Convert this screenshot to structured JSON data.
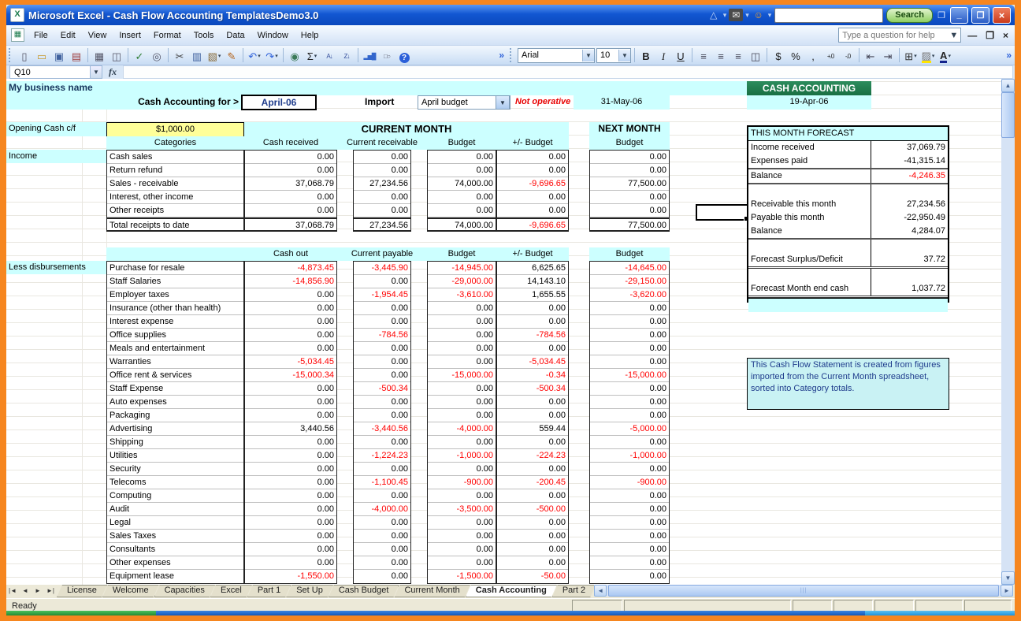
{
  "colors": {
    "orange_frame": "#f6861f",
    "cyan_band": "#ccffff",
    "green_header": "#1e7b4d",
    "negative_red": "#ff0000",
    "navy_header": "#1f3c8c",
    "yellow_cell": "#ffff99",
    "titlebar_blue": "#0f54d0"
  },
  "title_bar": {
    "title": "Microsoft Excel - Cash Flow Accounting TemplatesDemo3.0",
    "search_button_label": "Search",
    "addon_icons": [
      "logo-triangle-icon",
      "mail-icon",
      "buddy-icon"
    ]
  },
  "menu_bar": {
    "menus": [
      "File",
      "Edit",
      "View",
      "Insert",
      "Format",
      "Tools",
      "Data",
      "Window",
      "Help"
    ],
    "help_placeholder": "Type a question for help"
  },
  "toolbars": {
    "font_name": "Arial",
    "font_size": "10",
    "standard": [
      {
        "name": "new-icon"
      },
      {
        "name": "open-icon"
      },
      {
        "name": "save-icon"
      },
      {
        "name": "permission-icon"
      },
      {
        "sep": true
      },
      {
        "name": "print-icon"
      },
      {
        "name": "print-preview-icon"
      },
      {
        "sep": true
      },
      {
        "name": "spelling-icon"
      },
      {
        "name": "research-icon"
      },
      {
        "sep": true
      },
      {
        "name": "cut-icon"
      },
      {
        "name": "copy-icon"
      },
      {
        "name": "paste-icon",
        "drop": true
      },
      {
        "name": "format-painter-icon"
      },
      {
        "sep": true
      },
      {
        "name": "undo-icon",
        "drop": true
      },
      {
        "name": "redo-icon",
        "drop": true
      },
      {
        "sep": true
      },
      {
        "name": "insert-hyperlink-icon"
      },
      {
        "name": "autosum-icon",
        "drop": true
      },
      {
        "name": "sort-ascending-icon"
      },
      {
        "name": "sort-descending-icon"
      },
      {
        "sep": true
      },
      {
        "name": "chart-wizard-icon"
      },
      {
        "name": "drawing-icon"
      },
      {
        "name": "help-icon"
      }
    ],
    "formatting": [
      {
        "name": "bold-icon"
      },
      {
        "name": "italic-icon"
      },
      {
        "name": "underline-icon"
      },
      {
        "sep": true
      },
      {
        "name": "align-left-icon"
      },
      {
        "name": "align-center-icon"
      },
      {
        "name": "align-right-icon"
      },
      {
        "name": "merge-center-icon"
      },
      {
        "sep": true
      },
      {
        "name": "currency-icon"
      },
      {
        "name": "percent-icon"
      },
      {
        "name": "comma-style-icon"
      },
      {
        "name": "increase-decimal-icon"
      },
      {
        "name": "decrease-decimal-icon"
      },
      {
        "sep": true
      },
      {
        "name": "decrease-indent-icon"
      },
      {
        "name": "increase-indent-icon"
      },
      {
        "sep": true
      },
      {
        "name": "borders-icon",
        "drop": true
      },
      {
        "name": "fill-color-icon",
        "drop": true
      },
      {
        "name": "font-color-icon",
        "drop": true
      }
    ]
  },
  "formula_bar": {
    "name_box": "Q10"
  },
  "sheet": {
    "business_name": "My business name",
    "cash_accounting_for_label": "Cash Accounting for >",
    "period": "April-06",
    "import_label": "Import",
    "import_value": "April budget",
    "not_operative": "Not operative",
    "statement_date": "31-May-06",
    "cash_accounting_header": "CASH ACCOUNTING",
    "cash_accounting_date": "19-Apr-06",
    "opening_cash_label": "Opening Cash c/f",
    "opening_cash_value": "$1,000.00",
    "current_month_header": "CURRENT MONTH",
    "next_month_header": "NEXT MONTH",
    "next_month_subheader": "Budget",
    "income_label": "Income",
    "less_disbursements_label": "Less disbursements",
    "income_headers": [
      "Categories",
      "Cash received",
      "Current receivable",
      "Budget",
      "+/- Budget",
      "Budget"
    ],
    "income_rows": [
      {
        "label": "Cash sales",
        "values": [
          "0.00",
          "0.00",
          "0.00",
          "0.00",
          "0.00"
        ]
      },
      {
        "label": "Return refund",
        "values": [
          "0.00",
          "0.00",
          "0.00",
          "0.00",
          "0.00"
        ]
      },
      {
        "label": "Sales - receivable",
        "values": [
          "37,068.79",
          "27,234.56",
          "74,000.00",
          "-9,696.65",
          "77,500.00"
        ]
      },
      {
        "label": "Interest, other income",
        "values": [
          "0.00",
          "0.00",
          "0.00",
          "0.00",
          "0.00"
        ]
      },
      {
        "label": "Other receipts",
        "values": [
          "0.00",
          "0.00",
          "0.00",
          "0.00",
          "0.00"
        ]
      },
      {
        "label": "Total receipts to date",
        "values": [
          "37,068.79",
          "27,234.56",
          "74,000.00",
          "-9,696.65",
          "77,500.00"
        ]
      }
    ],
    "disbursement_headers": [
      "Cash out",
      "Current payable",
      "Budget",
      "+/- Budget",
      "Budget"
    ],
    "disbursement_rows": [
      {
        "label": "Purchase for resale",
        "values": [
          "-4,873.45",
          "-3,445.90",
          "-14,945.00",
          "6,625.65",
          "-14,645.00"
        ]
      },
      {
        "label": "Staff Salaries",
        "values": [
          "-14,856.90",
          "0.00",
          "-29,000.00",
          "14,143.10",
          "-29,150.00"
        ]
      },
      {
        "label": "Employer taxes",
        "values": [
          "0.00",
          "-1,954.45",
          "-3,610.00",
          "1,655.55",
          "-3,620.00"
        ]
      },
      {
        "label": "Insurance (other than health)",
        "values": [
          "0.00",
          "0.00",
          "0.00",
          "0.00",
          "0.00"
        ]
      },
      {
        "label": "Interest expense",
        "values": [
          "0.00",
          "0.00",
          "0.00",
          "0.00",
          "0.00"
        ]
      },
      {
        "label": "Office supplies",
        "values": [
          "0.00",
          "-784.56",
          "0.00",
          "-784.56",
          "0.00"
        ]
      },
      {
        "label": "Meals and entertainment",
        "values": [
          "0.00",
          "0.00",
          "0.00",
          "0.00",
          "0.00"
        ]
      },
      {
        "label": "Warranties",
        "values": [
          "-5,034.45",
          "0.00",
          "0.00",
          "-5,034.45",
          "0.00"
        ]
      },
      {
        "label": "Office rent & services",
        "values": [
          "-15,000.34",
          "0.00",
          "-15,000.00",
          "-0.34",
          "-15,000.00"
        ]
      },
      {
        "label": "Staff Expense",
        "values": [
          "0.00",
          "-500.34",
          "0.00",
          "-500.34",
          "0.00"
        ]
      },
      {
        "label": "Auto expenses",
        "values": [
          "0.00",
          "0.00",
          "0.00",
          "0.00",
          "0.00"
        ]
      },
      {
        "label": "Packaging",
        "values": [
          "0.00",
          "0.00",
          "0.00",
          "0.00",
          "0.00"
        ]
      },
      {
        "label": "Advertising",
        "values": [
          "3,440.56",
          "-3,440.56",
          "-4,000.00",
          "559.44",
          "-5,000.00"
        ]
      },
      {
        "label": "Shipping",
        "values": [
          "0.00",
          "0.00",
          "0.00",
          "0.00",
          "0.00"
        ]
      },
      {
        "label": "Utilities",
        "values": [
          "0.00",
          "-1,224.23",
          "-1,000.00",
          "-224.23",
          "-1,000.00"
        ]
      },
      {
        "label": "Security",
        "values": [
          "0.00",
          "0.00",
          "0.00",
          "0.00",
          "0.00"
        ]
      },
      {
        "label": "Telecoms",
        "values": [
          "0.00",
          "-1,100.45",
          "-900.00",
          "-200.45",
          "-900.00"
        ]
      },
      {
        "label": "Computing",
        "values": [
          "0.00",
          "0.00",
          "0.00",
          "0.00",
          "0.00"
        ]
      },
      {
        "label": "Audit",
        "values": [
          "0.00",
          "-4,000.00",
          "-3,500.00",
          "-500.00",
          "0.00"
        ]
      },
      {
        "label": "Legal",
        "values": [
          "0.00",
          "0.00",
          "0.00",
          "0.00",
          "0.00"
        ]
      },
      {
        "label": "Sales Taxes",
        "values": [
          "0.00",
          "0.00",
          "0.00",
          "0.00",
          "0.00"
        ]
      },
      {
        "label": "Consultants",
        "values": [
          "0.00",
          "0.00",
          "0.00",
          "0.00",
          "0.00"
        ]
      },
      {
        "label": "Other expenses",
        "values": [
          "0.00",
          "0.00",
          "0.00",
          "0.00",
          "0.00"
        ]
      },
      {
        "label": "Equipment lease",
        "values": [
          "-1,550.00",
          "0.00",
          "-1,500.00",
          "-50.00",
          "0.00"
        ]
      }
    ],
    "forecast": {
      "title": "THIS MONTH FORECAST",
      "rows": [
        {
          "label": "Income received",
          "value": "37,069.79"
        },
        {
          "label": "Expenses paid",
          "value": "-41,315.14"
        },
        {
          "label": "Balance",
          "value": "-4,246.35",
          "red": true
        },
        {
          "label": "",
          "value": ""
        },
        {
          "label": "Receivable this month",
          "value": "27,234.56"
        },
        {
          "label": "Payable this month",
          "value": "-22,950.49"
        },
        {
          "label": "Balance",
          "value": "4,284.07"
        },
        {
          "label": "",
          "value": ""
        },
        {
          "label": "Forecast Surplus/Deficit",
          "value": "37.72"
        },
        {
          "label": "",
          "value": ""
        },
        {
          "label": "Forecast Month end cash",
          "value": "1,037.72"
        }
      ]
    },
    "note": "This Cash Flow Statement is created from figures imported from the Current Month spreadsheet, sorted into Category totals."
  },
  "tabs": {
    "nav_icons": [
      "tab-first-icon",
      "tab-prev-icon",
      "tab-next-icon",
      "tab-last-icon"
    ],
    "items": [
      "License",
      "Welcome",
      "Capacities",
      "Excel",
      "Part 1",
      "Set Up",
      "Cash Budget",
      "Current Month",
      "Cash Accounting",
      "Part 2"
    ],
    "active": "Cash Accounting"
  },
  "status_bar": {
    "text": "Ready"
  }
}
